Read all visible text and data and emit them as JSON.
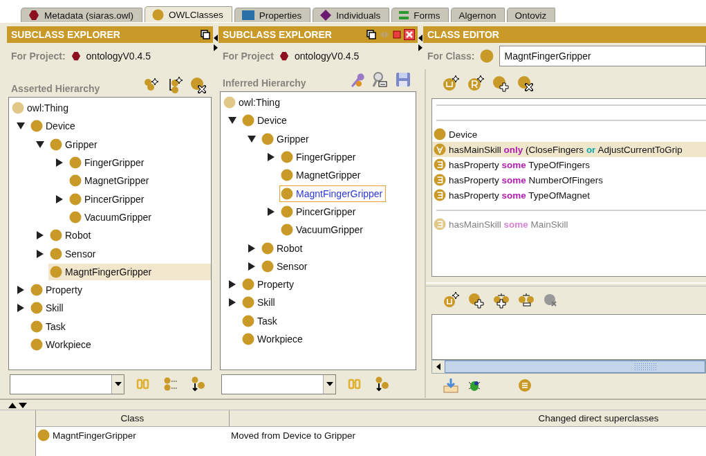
{
  "tabs": [
    {
      "label": "Metadata (siaras.owl)",
      "selected": false
    },
    {
      "label": "OWLClasses",
      "selected": true
    },
    {
      "label": "Properties",
      "selected": false
    },
    {
      "label": "Individuals",
      "selected": false
    },
    {
      "label": "Forms",
      "selected": false
    },
    {
      "label": "Algernon",
      "selected": false
    },
    {
      "label": "Ontoviz",
      "selected": false
    }
  ],
  "explorers": [
    {
      "title": "SUBCLASS EXPLORER",
      "project_label": "For Project:",
      "project": "ontologyV0.4.5",
      "hierarchy_label": "Asserted Hierarchy",
      "focused": false,
      "tree": {
        "root": "owl:Thing",
        "items": [
          {
            "label": "Device",
            "kind": "branch",
            "expanded": true,
            "selected": false,
            "children": [
              {
                "label": "Gripper",
                "kind": "branch",
                "expanded": true,
                "selected": false,
                "children": [
                  {
                    "label": "FingerGripper",
                    "kind": "branch",
                    "expanded": false,
                    "selected": false
                  },
                  {
                    "label": "MagnetGripper",
                    "kind": "leaf",
                    "selected": false
                  },
                  {
                    "label": "PincerGripper",
                    "kind": "branch",
                    "expanded": false,
                    "selected": false
                  },
                  {
                    "label": "VacuumGripper",
                    "kind": "leaf",
                    "selected": false
                  }
                ]
              },
              {
                "label": "Robot",
                "kind": "branch",
                "expanded": false,
                "selected": false
              },
              {
                "label": "Sensor",
                "kind": "branch",
                "expanded": false,
                "selected": false
              },
              {
                "label": "MagntFingerGripper",
                "kind": "leaf",
                "selected": true
              }
            ]
          },
          {
            "label": "Property",
            "kind": "branch",
            "expanded": false,
            "selected": false
          },
          {
            "label": "Skill",
            "kind": "branch",
            "expanded": false,
            "selected": false
          },
          {
            "label": "Task",
            "kind": "leaf",
            "selected": false
          },
          {
            "label": "Workpiece",
            "kind": "leaf",
            "selected": false
          }
        ]
      }
    },
    {
      "title": "SUBCLASS EXPLORER",
      "project_label": "For Project",
      "project": "ontologyV0.4.5",
      "hierarchy_label": "Inferred Hierarchy",
      "focused": true,
      "tree": {
        "root": "owl:Thing",
        "items": [
          {
            "label": "Device",
            "kind": "branch",
            "expanded": true,
            "selected": false,
            "children": [
              {
                "label": "Gripper",
                "kind": "branch",
                "expanded": true,
                "selected": false,
                "children": [
                  {
                    "label": "FingerGripper",
                    "kind": "branch",
                    "expanded": false,
                    "selected": false
                  },
                  {
                    "label": "MagnetGripper",
                    "kind": "leaf",
                    "selected": false
                  },
                  {
                    "label": "MagntFingerGripper",
                    "kind": "leaf",
                    "selected": true
                  },
                  {
                    "label": "PincerGripper",
                    "kind": "branch",
                    "expanded": false,
                    "selected": false
                  },
                  {
                    "label": "VacuumGripper",
                    "kind": "leaf",
                    "selected": false
                  }
                ]
              },
              {
                "label": "Robot",
                "kind": "branch",
                "expanded": false,
                "selected": false
              },
              {
                "label": "Sensor",
                "kind": "branch",
                "expanded": false,
                "selected": false
              }
            ]
          },
          {
            "label": "Property",
            "kind": "branch",
            "expanded": false,
            "selected": false
          },
          {
            "label": "Skill",
            "kind": "branch",
            "expanded": false,
            "selected": false
          },
          {
            "label": "Task",
            "kind": "leaf",
            "selected": false
          },
          {
            "label": "Workpiece",
            "kind": "leaf",
            "selected": false
          }
        ]
      }
    }
  ],
  "class_editor": {
    "title": "CLASS EDITOR",
    "class_label": "For Class:",
    "class_name": "MagntFingerGripper",
    "sections": [
      {
        "rows": [
          {
            "kind": "class",
            "selected": false,
            "inherited": false,
            "parts": [
              {
                "text": "Device",
                "kind": "name"
              }
            ]
          },
          {
            "kind": "all",
            "selected": true,
            "inherited": false,
            "parts": [
              {
                "text": "hasMainSkill",
                "kind": "name"
              },
              {
                "text": "only",
                "kind": "quantifier"
              },
              {
                "text": "(CloseFingers",
                "kind": "name"
              },
              {
                "text": "or",
                "kind": "operator"
              },
              {
                "text": "AdjustCurrentToGrip",
                "kind": "name"
              }
            ]
          },
          {
            "kind": "some",
            "selected": false,
            "inherited": false,
            "parts": [
              {
                "text": "hasProperty",
                "kind": "name"
              },
              {
                "text": "some",
                "kind": "quantifier"
              },
              {
                "text": "TypeOfFingers",
                "kind": "name"
              }
            ]
          },
          {
            "kind": "some",
            "selected": false,
            "inherited": false,
            "parts": [
              {
                "text": "hasProperty",
                "kind": "name"
              },
              {
                "text": "some",
                "kind": "quantifier"
              },
              {
                "text": "NumberOfFingers",
                "kind": "name"
              }
            ]
          },
          {
            "kind": "some",
            "selected": false,
            "inherited": false,
            "parts": [
              {
                "text": "hasProperty",
                "kind": "name"
              },
              {
                "text": "some",
                "kind": "quantifier"
              },
              {
                "text": "TypeOfMagnet",
                "kind": "name"
              }
            ]
          }
        ]
      },
      {
        "rows": [
          {
            "kind": "some",
            "selected": false,
            "inherited": true,
            "parts": [
              {
                "text": "hasMainSkill",
                "kind": "name"
              },
              {
                "text": "some",
                "kind": "quantifier"
              },
              {
                "text": "MainSkill",
                "kind": "name"
              }
            ]
          }
        ]
      }
    ]
  },
  "changes_table": {
    "columns": [
      "Class",
      "Changed direct superclasses"
    ],
    "rows": [
      {
        "cells": [
          "MagntFingerGripper",
          "Moved from Device to Gripper"
        ]
      }
    ]
  }
}
